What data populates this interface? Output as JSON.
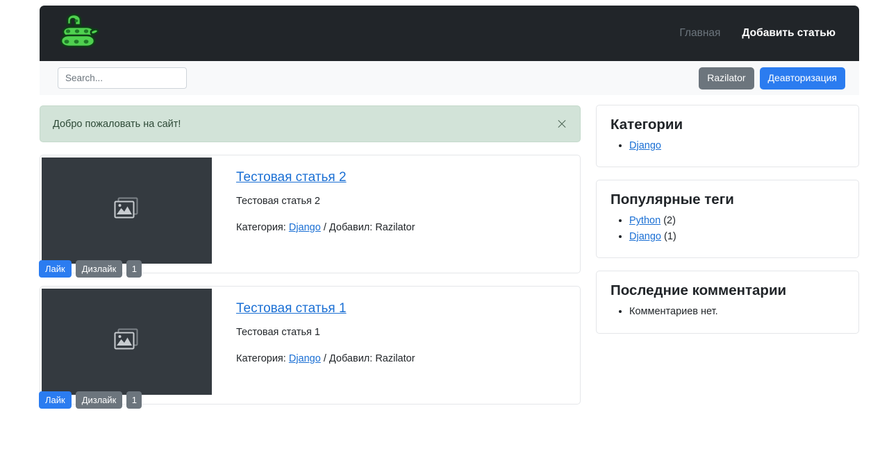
{
  "navbar": {
    "logo_icon": "green-snake-logo",
    "links": [
      {
        "label": "Главная",
        "active": false
      },
      {
        "label": "Добавить статью",
        "active": true
      }
    ]
  },
  "searchbar": {
    "search_placeholder": "Search...",
    "search_value": "",
    "user_button": "Razilator",
    "logout_button": "Деавторизация",
    "primary_color": "#2b7cf0",
    "secondary_color": "#6c757d"
  },
  "alert": {
    "message": "Добро пожаловать на сайт!",
    "close_icon": "close-icon",
    "background": "#d2e3d8"
  },
  "articles": [
    {
      "title": "Тестовая статья 2",
      "description": "Тестовая статья 2",
      "meta_prefix": "Категория:",
      "category": "Django",
      "meta_separator": "/ Добавил:",
      "author": "Razilator",
      "thumb_icon": "image-placeholder-icon",
      "like_label": "Лайк",
      "dislike_label": "Дизлайк",
      "count": "1"
    },
    {
      "title": "Тестовая статья 1",
      "description": "Тестовая статья 1",
      "meta_prefix": "Категория:",
      "category": "Django",
      "meta_separator": "/ Добавил:",
      "author": "Razilator",
      "thumb_icon": "image-placeholder-icon",
      "like_label": "Лайк",
      "dislike_label": "Дизлайк",
      "count": "1"
    }
  ],
  "sidebar": {
    "categories": {
      "title": "Категории",
      "items": [
        {
          "label": "Django",
          "count": ""
        }
      ]
    },
    "tags": {
      "title": "Популярные теги",
      "items": [
        {
          "label": "Python",
          "count": "(2)"
        },
        {
          "label": "Django",
          "count": "(1)"
        }
      ]
    },
    "comments": {
      "title": "Последние комментарии",
      "items": [
        {
          "label": "Комментариев нет."
        }
      ]
    }
  }
}
